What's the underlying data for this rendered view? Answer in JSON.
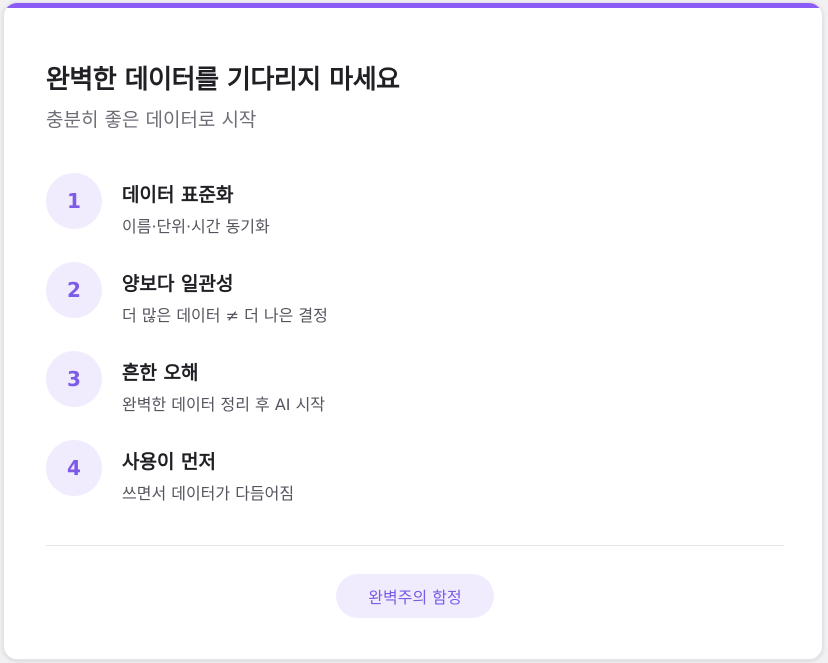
{
  "card": {
    "title": "완벽한 데이터를 기다리지 마세요",
    "subtitle": "충분히 좋은 데이터로 시작",
    "accent_color": "#8b5cf6",
    "steps": [
      {
        "number": "1",
        "title": "데이터 표준화",
        "desc": "이름·단위·시간 동기화"
      },
      {
        "number": "2",
        "title": "양보다 일관성",
        "desc": "더 많은 데이터 ≠ 더 나은 결정"
      },
      {
        "number": "3",
        "title": "흔한 오해",
        "desc": "완벽한 데이터 정리 후 AI 시작"
      },
      {
        "number": "4",
        "title": "사용이 먼저",
        "desc": "쓰면서 데이터가 다듬어짐"
      }
    ],
    "pill_label": "완벽주의 함정"
  }
}
